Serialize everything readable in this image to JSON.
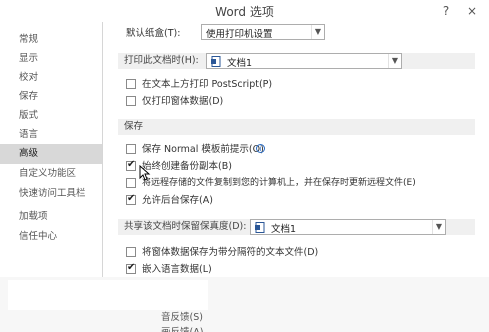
{
  "window": {
    "title": "Word 选项",
    "help_glyph": "?",
    "close_glyph": "×"
  },
  "sidebar": {
    "items": [
      {
        "label": "常规"
      },
      {
        "label": "显示"
      },
      {
        "label": "校对"
      },
      {
        "label": "保存"
      },
      {
        "label": "版式"
      },
      {
        "label": "语言"
      },
      {
        "label": "高级",
        "active": true
      },
      {
        "label": "自定义功能区"
      },
      {
        "label": "快速访问工具栏"
      },
      {
        "label": "加载项"
      },
      {
        "label": "信任中心"
      }
    ]
  },
  "print": {
    "default_tray_label": "默认纸盒(T):",
    "default_tray_value": "使用打印机设置",
    "print_doc_label": "打印此文档时(H):",
    "print_doc_value": "文档1",
    "postscript_label": "在文本上方打印 PostScript(P)",
    "postscript_checked": false,
    "form_data_label": "仅打印窗体数据(D)",
    "form_data_checked": false
  },
  "save": {
    "section_title": "保存",
    "prompt_normal_label": "保存 Normal 模板前提示(O)",
    "prompt_normal_checked": false,
    "info_glyph": "i",
    "backup_label": "始终创建备份副本(B)",
    "backup_checked": true,
    "remote_copy_label": "将远程存储的文件复制到您的计算机上，并在保存时更新远程文件(E)",
    "remote_copy_checked": false,
    "background_save_label": "允许后台保存(A)",
    "background_save_checked": true
  },
  "fidelity": {
    "section_label": "共享该文档时保留保真度(D):",
    "doc_value": "文档1",
    "save_form_data_label": "将窗体数据保存为带分隔符的文本文件(D)",
    "save_form_data_checked": false,
    "embed_lang_label": "嵌入语言数据(L)",
    "embed_lang_checked": true
  },
  "partial": {
    "line1": "音反馈(S)",
    "line2": "画反馈(A)"
  }
}
